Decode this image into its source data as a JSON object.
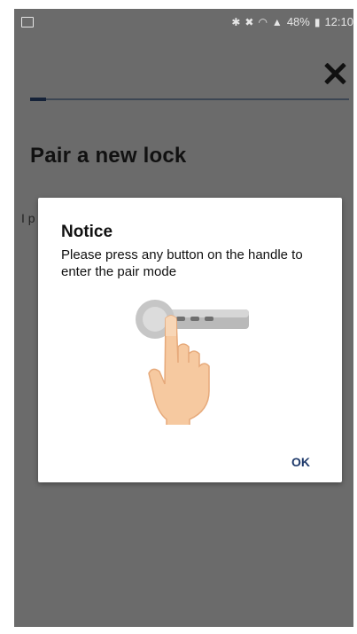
{
  "status_bar": {
    "gallery_icon": "image-icon",
    "bluetooth_icon": "bluetooth-icon",
    "mute_icon": "mute-icon",
    "wifi_icon": "wifi-icon",
    "signal_icon": "signal-icon",
    "battery_text": "48%",
    "battery_icon": "battery-icon",
    "time": "12:10"
  },
  "header": {
    "close_icon": "close-icon",
    "progress_fraction": 0.05
  },
  "page": {
    "title": "Pair a new lock",
    "body_partial": "I p"
  },
  "dialog": {
    "title": "Notice",
    "message": "Please press any button on the handle to enter the pair mode",
    "illustration": "hand-pressing-handle-icon",
    "ok_label": "OK"
  },
  "colors": {
    "overlay": "#6b6b6b",
    "accent": "#1f3a6b",
    "progress": "#152238"
  }
}
